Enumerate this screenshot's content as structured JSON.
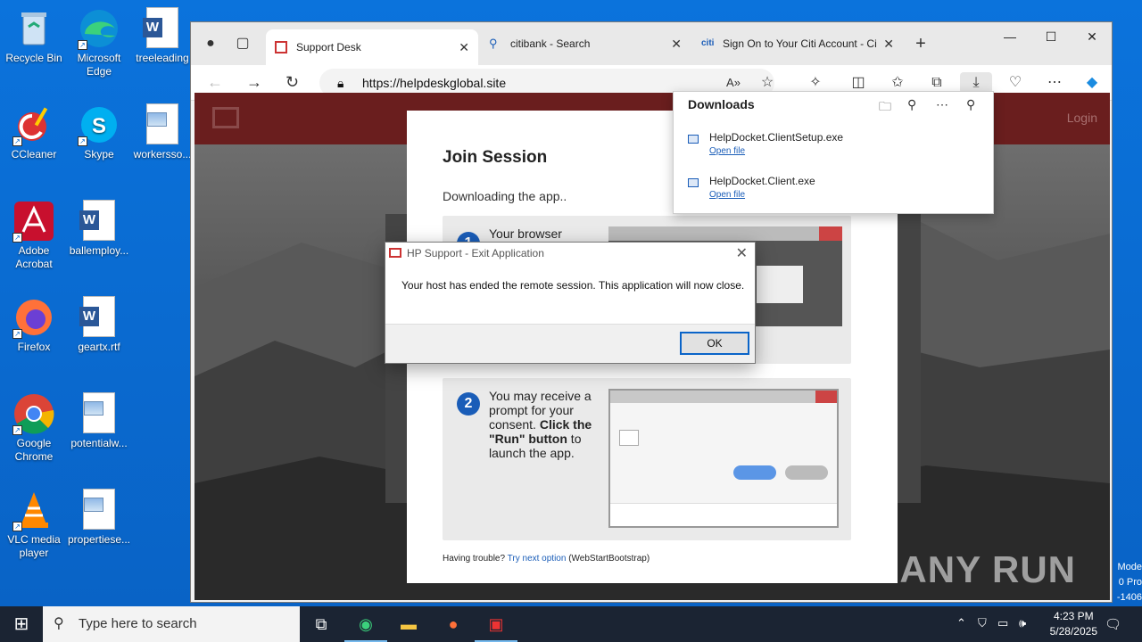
{
  "desktop": {
    "icons": [
      {
        "label": "Recycle Bin"
      },
      {
        "label": "Microsoft Edge"
      },
      {
        "label": "treeleading"
      },
      {
        "label": "CCleaner"
      },
      {
        "label": "Skype"
      },
      {
        "label": "workersso..."
      },
      {
        "label": "Adobe Acrobat"
      },
      {
        "label": "ballemploy..."
      },
      {
        "label": "Firefox"
      },
      {
        "label": "geartx.rtf"
      },
      {
        "label": "Google Chrome"
      },
      {
        "label": "potentialw..."
      },
      {
        "label": "VLC media player"
      },
      {
        "label": "propertiese..."
      }
    ],
    "side_text": [
      "Mode",
      "0 Pro",
      "-1406"
    ]
  },
  "browser": {
    "tabs": [
      {
        "label": "Support Desk",
        "active": true
      },
      {
        "label": "citibank - Search",
        "active": false
      },
      {
        "label": "Sign On to Your Citi Account - Ci",
        "active": false
      }
    ],
    "url": "https://helpdeskglobal.site",
    "window_controls": {
      "minimize": "—",
      "maximize": "☐",
      "close": "✕"
    }
  },
  "page": {
    "login": "Login",
    "title": "Join Session",
    "subtitle": "Downloading the app..",
    "step1": {
      "num": "1",
      "text": "Your browser"
    },
    "step2": {
      "num": "2",
      "text_a": "You may receive a prompt for your consent. ",
      "text_b": "Click the \"Run\" button",
      "text_c": " to launch the app."
    },
    "trouble_prefix": "Having trouble? ",
    "trouble_link": "Try next option",
    "trouble_suffix": " (WebStartBootstrap)",
    "watermark": "ANY RUN"
  },
  "downloads": {
    "title": "Downloads",
    "items": [
      {
        "name": "HelpDocket.ClientSetup.exe",
        "action": "Open file"
      },
      {
        "name": "HelpDocket.Client.exe",
        "action": "Open file"
      }
    ]
  },
  "dialog": {
    "title": "HP Support - Exit Application",
    "message": "Your host has ended the remote session. This application will now close.",
    "ok": "OK"
  },
  "taskbar": {
    "search_placeholder": "Type here to search",
    "time": "4:23 PM",
    "date": "5/28/2025"
  },
  "colors": {
    "accent": "#0a64c8",
    "header": "#6a1e1e",
    "step_num": "#1a5db8"
  }
}
